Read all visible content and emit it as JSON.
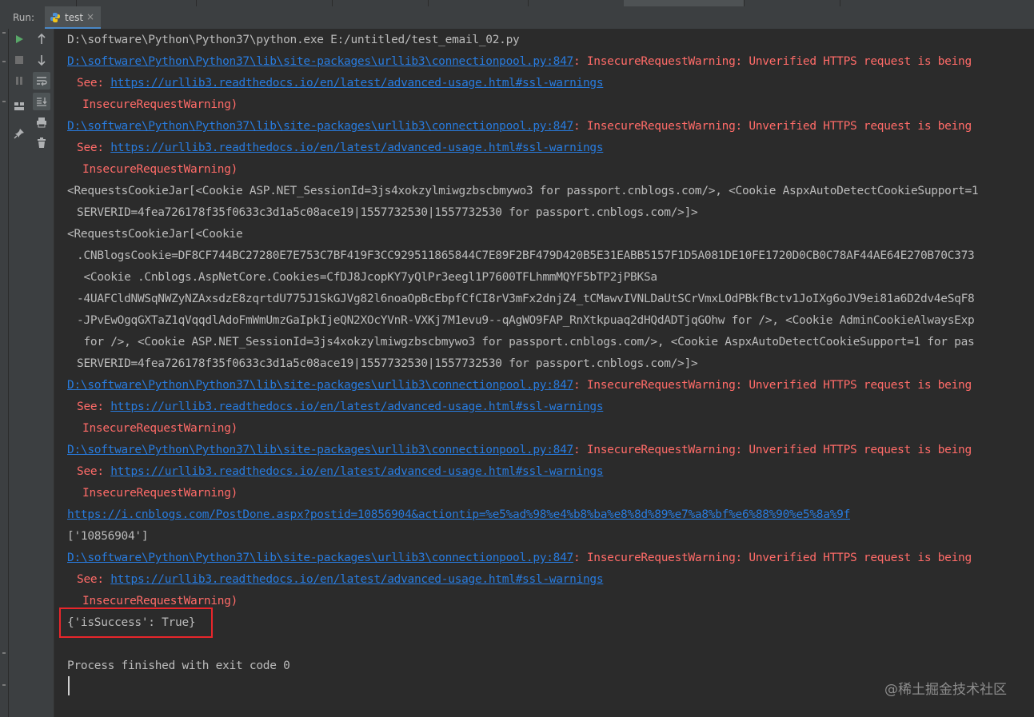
{
  "run_panel": {
    "label": "Run:",
    "tab_name": "test",
    "tab_close": "×"
  },
  "toolbar": {
    "column1": [
      "run-icon",
      "stop-icon",
      "pause-icon",
      "layout-icon",
      "pin-icon"
    ],
    "column2": [
      "arrow-up-icon",
      "arrow-down-icon",
      "soft-wrap-icon",
      "scroll-to-end-icon",
      "print-icon",
      "trash-icon"
    ]
  },
  "console": {
    "lines": [
      {
        "parts": [
          {
            "text": "D:\\software\\Python\\Python37\\python.exe E:/untitled/test_email_02.py",
            "style": "normal"
          }
        ]
      },
      {
        "parts": [
          {
            "text": "D:\\software\\Python\\Python37\\lib\\site-packages\\urllib3\\connectionpool.py:847",
            "style": "link"
          },
          {
            "text": ": InsecureRequestWarning: Unverified HTTPS request is being",
            "style": "err"
          }
        ]
      },
      {
        "indent": "ind1",
        "parts": [
          {
            "text": "See: ",
            "style": "err"
          },
          {
            "text": "https://urllib3.readthedocs.io/en/latest/advanced-usage.html#ssl-warnings",
            "style": "link"
          }
        ]
      },
      {
        "indent": "ind2",
        "parts": [
          {
            "text": "InsecureRequestWarning)",
            "style": "err"
          }
        ]
      },
      {
        "parts": [
          {
            "text": "D:\\software\\Python\\Python37\\lib\\site-packages\\urllib3\\connectionpool.py:847",
            "style": "link"
          },
          {
            "text": ": InsecureRequestWarning: Unverified HTTPS request is being",
            "style": "err"
          }
        ]
      },
      {
        "indent": "ind1",
        "parts": [
          {
            "text": "See: ",
            "style": "err"
          },
          {
            "text": "https://urllib3.readthedocs.io/en/latest/advanced-usage.html#ssl-warnings",
            "style": "link"
          }
        ]
      },
      {
        "indent": "ind2",
        "parts": [
          {
            "text": "InsecureRequestWarning)",
            "style": "err"
          }
        ]
      },
      {
        "parts": [
          {
            "text": "<RequestsCookieJar[<Cookie ASP.NET_SessionId=3js4xokzylmiwgzbscbmywo3 for passport.cnblogs.com/>, <Cookie AspxAutoDetectCookieSupport=1",
            "style": "normal"
          }
        ]
      },
      {
        "indent": "ind1",
        "parts": [
          {
            "text": "SERVERID=4fea726178f35f0633c3d1a5c08ace19|1557732530|1557732530 for passport.cnblogs.com/>]>",
            "style": "normal"
          }
        ]
      },
      {
        "parts": [
          {
            "text": "<RequestsCookieJar[<Cookie",
            "style": "normal"
          }
        ]
      },
      {
        "indent": "ind1",
        "parts": [
          {
            "text": ".CNBlogsCookie=DF8CF744BC27280E7E753C7BF419F3CC929511865844C7E89F2BF479D420B5E31EABB5157F1D5A081DE10FE1720D0CB0C78AF44AE64E270B70C373",
            "style": "normal"
          }
        ]
      },
      {
        "indent": "ind1",
        "parts": [
          {
            "text": " <Cookie .Cnblogs.AspNetCore.Cookies=CfDJ8JcopKY7yQlPr3eegl1P7600TFLhmmMQYF5bTP2jPBKSa",
            "style": "normal"
          }
        ]
      },
      {
        "indent": "ind1",
        "parts": [
          {
            "text": "-4UAFCldNWSqNWZyNZAxsdzE8zqrtdU775J1SkGJVg82l6noaOpBcEbpfCfCI8rV3mFx2dnjZ4_tCMawvIVNLDaUtSCrVmxLOdPBkfBctv1JoIXg6oJV9ei81a6D2dv4eSqF8",
            "style": "normal"
          }
        ]
      },
      {
        "indent": "ind1",
        "parts": [
          {
            "text": "-JPvEwOgqGXTaZ1qVqqdlAdoFmWmUmzGaIpkIjeQN2XOcYVnR-VXKj7M1evu9--qAgWO9FAP_RnXtkpuaq2dHQdADTjqGOhw for />, <Cookie AdminCookieAlwaysExp",
            "style": "normal"
          }
        ]
      },
      {
        "indent": "ind1",
        "parts": [
          {
            "text": " for />, <Cookie ASP.NET_SessionId=3js4xokzylmiwgzbscbmywo3 for passport.cnblogs.com/>, <Cookie AspxAutoDetectCookieSupport=1 for pas",
            "style": "normal"
          }
        ]
      },
      {
        "indent": "ind1",
        "parts": [
          {
            "text": "SERVERID=4fea726178f35f0633c3d1a5c08ace19|1557732530|1557732530 for passport.cnblogs.com/>]>",
            "style": "normal"
          }
        ]
      },
      {
        "parts": [
          {
            "text": "D:\\software\\Python\\Python37\\lib\\site-packages\\urllib3\\connectionpool.py:847",
            "style": "link"
          },
          {
            "text": ": InsecureRequestWarning: Unverified HTTPS request is being",
            "style": "err"
          }
        ]
      },
      {
        "indent": "ind1",
        "parts": [
          {
            "text": "See: ",
            "style": "err"
          },
          {
            "text": "https://urllib3.readthedocs.io/en/latest/advanced-usage.html#ssl-warnings",
            "style": "link"
          }
        ]
      },
      {
        "indent": "ind2",
        "parts": [
          {
            "text": "InsecureRequestWarning)",
            "style": "err"
          }
        ]
      },
      {
        "parts": [
          {
            "text": "D:\\software\\Python\\Python37\\lib\\site-packages\\urllib3\\connectionpool.py:847",
            "style": "link"
          },
          {
            "text": ": InsecureRequestWarning: Unverified HTTPS request is being",
            "style": "err"
          }
        ]
      },
      {
        "indent": "ind1",
        "parts": [
          {
            "text": "See: ",
            "style": "err"
          },
          {
            "text": "https://urllib3.readthedocs.io/en/latest/advanced-usage.html#ssl-warnings",
            "style": "link"
          }
        ]
      },
      {
        "indent": "ind2",
        "parts": [
          {
            "text": "InsecureRequestWarning)",
            "style": "err"
          }
        ]
      },
      {
        "parts": [
          {
            "text": "https://i.cnblogs.com/PostDone.aspx?postid=10856904&actiontip=%e5%ad%98%e4%b8%ba%e8%8d%89%e7%a8%bf%e6%88%90%e5%8a%9f",
            "style": "link"
          }
        ]
      },
      {
        "parts": [
          {
            "text": "['10856904']",
            "style": "normal"
          }
        ]
      },
      {
        "parts": [
          {
            "text": "D:\\software\\Python\\Python37\\lib\\site-packages\\urllib3\\connectionpool.py:847",
            "style": "link"
          },
          {
            "text": ": InsecureRequestWarning: Unverified HTTPS request is being",
            "style": "err"
          }
        ]
      },
      {
        "indent": "ind1",
        "parts": [
          {
            "text": "See: ",
            "style": "err"
          },
          {
            "text": "https://urllib3.readthedocs.io/en/latest/advanced-usage.html#ssl-warnings",
            "style": "link"
          }
        ]
      },
      {
        "indent": "ind2",
        "parts": [
          {
            "text": "InsecureRequestWarning)",
            "style": "err"
          }
        ]
      },
      {
        "parts": [
          {
            "text": "{'isSuccess': True}",
            "style": "normal"
          }
        ]
      },
      {
        "parts": [
          {
            "text": "",
            "style": "normal"
          }
        ]
      },
      {
        "parts": [
          {
            "text": "Process finished with exit code 0",
            "style": "normal"
          }
        ]
      }
    ]
  },
  "watermark": "@稀土掘金技术社区",
  "colors": {
    "background": "#2b2b2b",
    "link": "#287bde",
    "error": "#ff6b68",
    "text": "#bbbbbb",
    "highlight_box": "#e8262b"
  }
}
